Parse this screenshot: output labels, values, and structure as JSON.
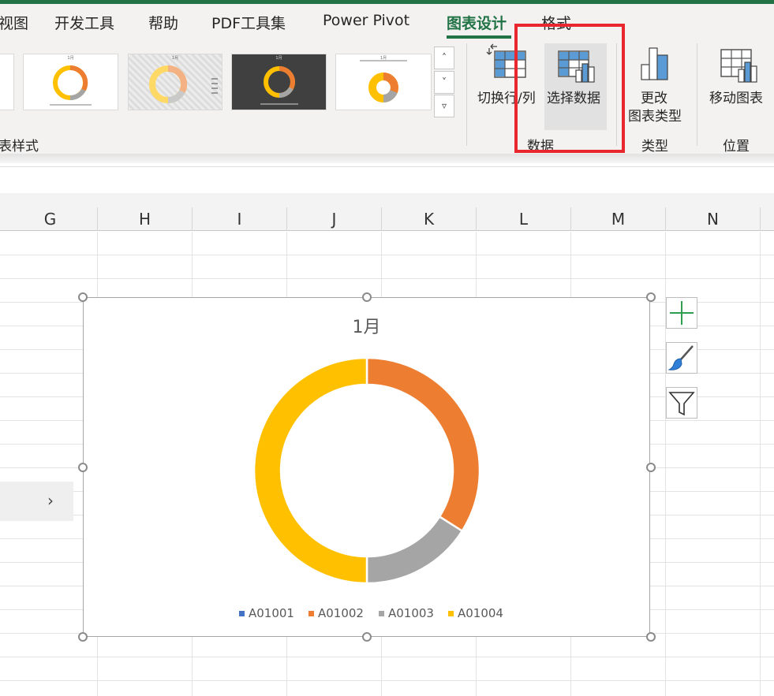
{
  "ribbon_tabs": [
    {
      "label": "视图",
      "active": false
    },
    {
      "label": "开发工具",
      "active": false
    },
    {
      "label": "帮助",
      "active": false
    },
    {
      "label": "PDF工具集",
      "active": false
    },
    {
      "label": "Power Pivot",
      "active": false
    },
    {
      "label": "图表设计",
      "active": true
    },
    {
      "label": "格式",
      "active": false
    }
  ],
  "groups": {
    "chart_styles": "表样式",
    "data": "数据",
    "type": "类型",
    "location": "位置"
  },
  "buttons": {
    "switch_row_col": "切换行/列",
    "select_data": "选择数据",
    "change_type_line1": "更改",
    "change_type_line2": "图表类型",
    "move_chart": "移动图表"
  },
  "style_thumbnails": [
    {
      "title": "1月"
    },
    {
      "title": "1月"
    },
    {
      "title": "1月"
    },
    {
      "title": "1月"
    }
  ],
  "columns": [
    "G",
    "H",
    "I",
    "J",
    "K",
    "L",
    "M",
    "N"
  ],
  "chart_data": {
    "type": "pie",
    "title": "1月",
    "donut": true,
    "series": [
      {
        "name": "",
        "categories": [
          "A01001",
          "A01002",
          "A01003",
          "A01004"
        ],
        "values": [
          0,
          34,
          16,
          50
        ]
      }
    ],
    "colors": [
      "#4472c4",
      "#ed7d31",
      "#a5a5a5",
      "#ffc000"
    ],
    "legend": "bottom"
  },
  "panel_tab": {
    "icon": "chevron-right-icon"
  },
  "colors": {
    "accent": "#217346",
    "highlight": "#e8282e"
  }
}
